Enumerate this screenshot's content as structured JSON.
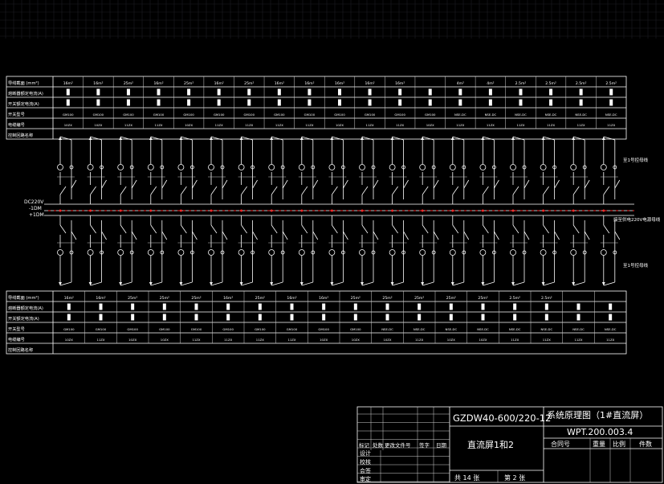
{
  "top_table": {
    "row_labels": [
      "导线截面 (mm²)",
      "熔断器额定电流(A)",
      "开关额定电流(A)",
      "开关型号",
      "电缆编号",
      "控制回路名称"
    ],
    "sizes": [
      "16m²",
      "16m²",
      "25m²",
      "16m²",
      "25m²",
      "16m²",
      "25m²",
      "16m²",
      "16m²",
      "16m²",
      "16m²",
      "16m²",
      "",
      "4m²",
      "4m²",
      "2.5m²",
      "2.5m²",
      "2.5m²",
      "2.5m²"
    ],
    "models": [
      "GM100",
      "GM100",
      "GM100",
      "GM100",
      "GM100",
      "GM100",
      "GM100",
      "GM100",
      "GM100",
      "GM100",
      "GM100",
      "GM100",
      "GM100",
      "NSE-DC",
      "NSE-DC",
      "NSE-DC",
      "NSE-DC",
      "NSE-DC",
      "NSE-DC"
    ],
    "cables": [
      "10ZX",
      "10ZX",
      "11ZX",
      "11ZX",
      "10ZX",
      "11ZX",
      "11ZX",
      "11ZX",
      "11ZX",
      "10ZX",
      "11ZX",
      "11ZX",
      "10ZX",
      "11ZX",
      "11ZX",
      "11ZX",
      "11ZX",
      "11ZX",
      "11ZX"
    ]
  },
  "bottom_table": {
    "row_labels": [
      "导线截面 (mm²)",
      "熔断器额定电流(A)",
      "开关额定电流(A)",
      "开关型号",
      "电缆编号",
      "控制回路名称"
    ],
    "sizes": [
      "16m²",
      "16m²",
      "25m²",
      "25m²",
      "25m²",
      "16m²",
      "25m²",
      "16m²",
      "16m²",
      "25m²",
      "25m²",
      "25m²",
      "25m²",
      "25m²",
      "2.5m²",
      "2.5m²",
      "",
      ""
    ],
    "models": [
      "GM100",
      "GM100",
      "GM100",
      "GM100",
      "GM100",
      "GM100",
      "GM100",
      "GM100",
      "GM100",
      "GM100",
      "NSE-DC",
      "NSE-DC",
      "NSE-DC",
      "NSE-DC",
      "NSE-DC",
      "NSE-DC",
      "NSE-DC",
      "NSE-DC"
    ],
    "cables": [
      "10ZX",
      "11ZX",
      "10ZX",
      "10ZX",
      "11ZX",
      "11ZX",
      "11ZX",
      "11ZX",
      "10ZX",
      "10ZX",
      "10ZX",
      "11ZX",
      "10ZX",
      "10ZX",
      "11ZX",
      "11ZX",
      "11ZX",
      "11ZX"
    ]
  },
  "bus": {
    "left_label_1": "DC220V",
    "left_label_2": "-1DM",
    "left_label_3": "+1DM",
    "right_label_top": "至1号控母线",
    "right_label_mid": "接至供电220V电源母线",
    "right_label_bot": "至1号控母线"
  },
  "title_block": {
    "doc_number_top": "GZDW40-600/220-12",
    "drawing_title": "系统原理图（1#直流屏）",
    "drawing_code": "WPT.200.003.4",
    "name_cell": "直流屏1和2",
    "hdr_mark": "标记",
    "hdr_count": "处数",
    "hdr_file": "更改文件号",
    "hdr_sign": "签字",
    "hdr_date": "日期",
    "role_design": "设计",
    "role_check": "校核",
    "role_review": "会签",
    "role_approve": "审定",
    "contract": "合同号",
    "weight": "重量",
    "scale": "比例",
    "quantity": "件数",
    "total_sheets": "共 14 张",
    "sheet_no": "第 2 张"
  }
}
